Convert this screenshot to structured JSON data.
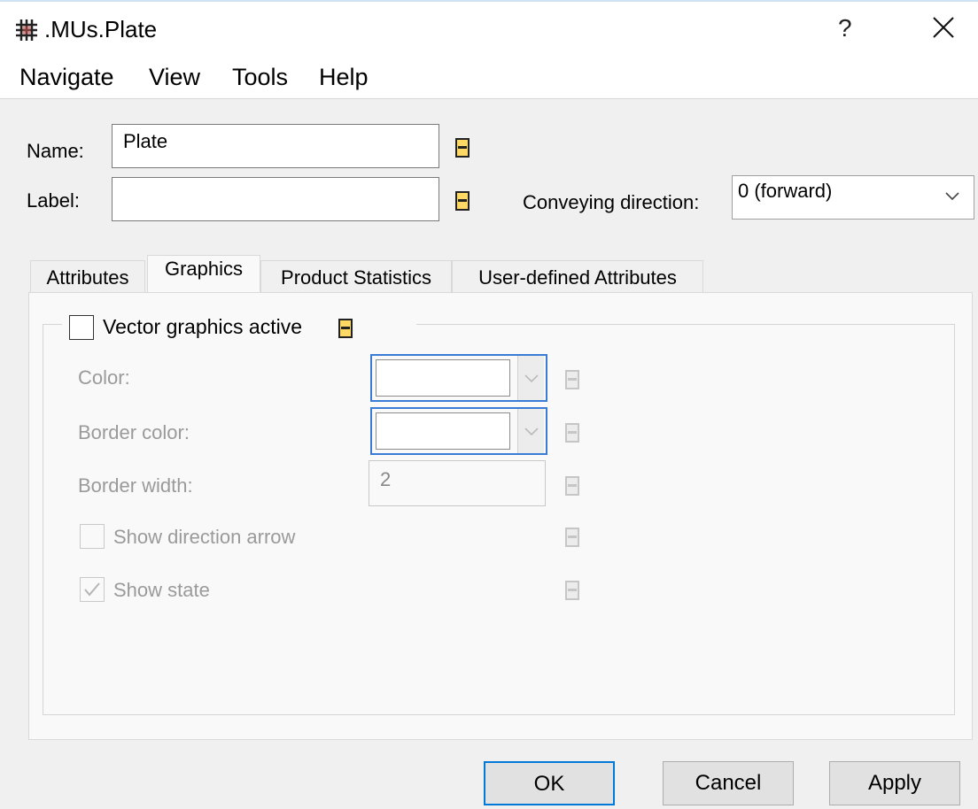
{
  "window": {
    "title": ".MUs.Plate",
    "help_label": "?"
  },
  "menu": [
    "Navigate",
    "View",
    "Tools",
    "Help"
  ],
  "form": {
    "name_label": "Name:",
    "name_value": "Plate",
    "label_label": "Label:",
    "label_value": "",
    "conveying_label": "Conveying direction:",
    "conveying_value": "0 (forward)"
  },
  "tabs": [
    {
      "label": "Attributes",
      "active": false
    },
    {
      "label": "Graphics",
      "active": true
    },
    {
      "label": "Product Statistics",
      "active": false
    },
    {
      "label": "User-defined Attributes",
      "active": false
    }
  ],
  "graphics": {
    "vector_active_label": "Vector graphics active",
    "vector_active_checked": false,
    "color_label": "Color:",
    "border_color_label": "Border color:",
    "border_width_label": "Border width:",
    "border_width_value": "2",
    "show_arrow_label": "Show direction arrow",
    "show_arrow_checked": false,
    "show_state_label": "Show state",
    "show_state_checked": true
  },
  "buttons": {
    "ok": "OK",
    "cancel": "Cancel",
    "apply": "Apply"
  },
  "colors": {
    "pin_active": "#ffd966",
    "focus_blue": "#0078d7",
    "disabled_text": "#9a9a9a"
  }
}
